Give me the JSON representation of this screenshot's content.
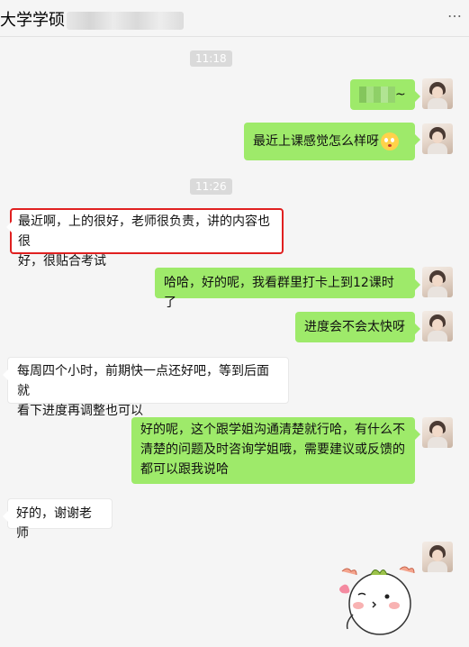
{
  "header": {
    "title": "大学学硕",
    "more_icon": "…"
  },
  "messages": [
    {
      "type": "time",
      "text": "11:18"
    },
    {
      "type": "msg",
      "side": "right",
      "suffix": "~"
    },
    {
      "type": "msg",
      "side": "right",
      "text": "最近上课感觉怎么样呀",
      "emoji": "smiling-face-icon"
    },
    {
      "type": "time",
      "text": "11:26"
    },
    {
      "type": "msg",
      "side": "left",
      "highlighted": true,
      "line1": "最近啊，上的很好，老师很负责，讲的内容也很",
      "line2": "好，很贴合考试"
    },
    {
      "type": "msg",
      "side": "right",
      "text": "哈哈，好的呢，我看群里打卡上到12课时了"
    },
    {
      "type": "msg",
      "side": "right",
      "text": "进度会不会太快呀"
    },
    {
      "type": "msg",
      "side": "left",
      "line1": "每周四个小时，前期快一点还好吧，等到后面就",
      "line2": "看下进度再调整也可以"
    },
    {
      "type": "msg",
      "side": "right",
      "line1": "好的呢，这个跟学姐沟通清楚就行哈，有什么不",
      "line2": "清楚的问题及时咨询学姐哦，需要建议或反馈的",
      "line3": "都可以跟我说哈"
    },
    {
      "type": "msg",
      "side": "left",
      "text": "好的，谢谢老师"
    },
    {
      "type": "sticker",
      "side": "right",
      "icon": "cute-bun-sticker-icon"
    }
  ],
  "colors": {
    "bubble_right": "#9eea6a",
    "bubble_left": "#ffffff",
    "highlight_border": "#e02020",
    "background": "#f5f5f5"
  }
}
